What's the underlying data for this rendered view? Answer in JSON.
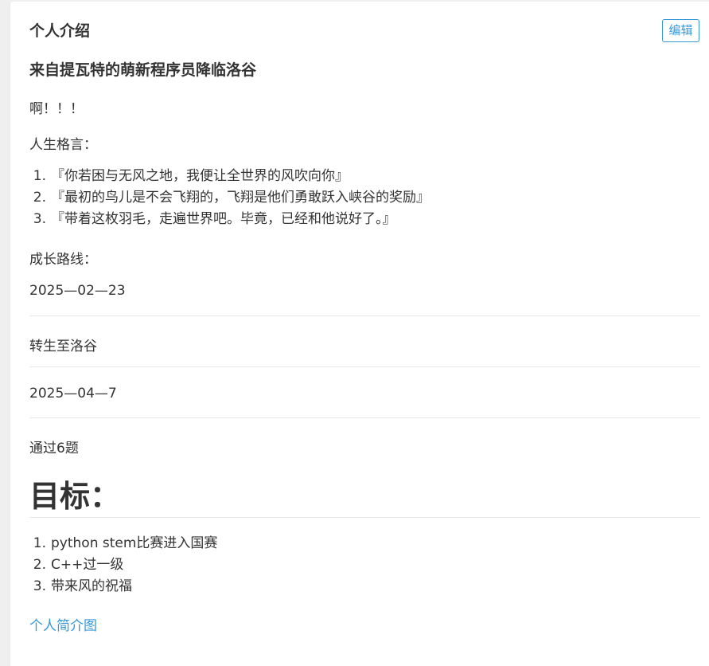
{
  "card": {
    "title": "个人介绍",
    "edit_label": "编辑"
  },
  "content": {
    "subtitle": "来自提瓦特的萌新程序员降临洛谷",
    "exclaim": "啊！！！",
    "motto_label": "人生格言：",
    "mottos": [
      "『你若困与无风之地，我便让全世界的风吹向你』",
      "『最初的鸟儿是不会飞翔的，飞翔是他们勇敢跃入峡谷的奖励』",
      "『带着这枚羽毛，走遍世界吧。毕竟，已经和他说好了。』"
    ],
    "growth_label": "成长路线：",
    "timeline": [
      "2025—02—23",
      "转生至洛谷",
      "2025—04—7",
      "通过6题"
    ],
    "goal_heading": "目标：",
    "goals": [
      "python stem比赛进入国赛",
      "C++过一级",
      "带来风的祝福"
    ],
    "link_label": "个人简介图"
  },
  "colors": {
    "accent": "#3498db",
    "text": "#333333",
    "background": "#efefef",
    "card": "#ffffff",
    "divider": "#e8e8e8"
  }
}
